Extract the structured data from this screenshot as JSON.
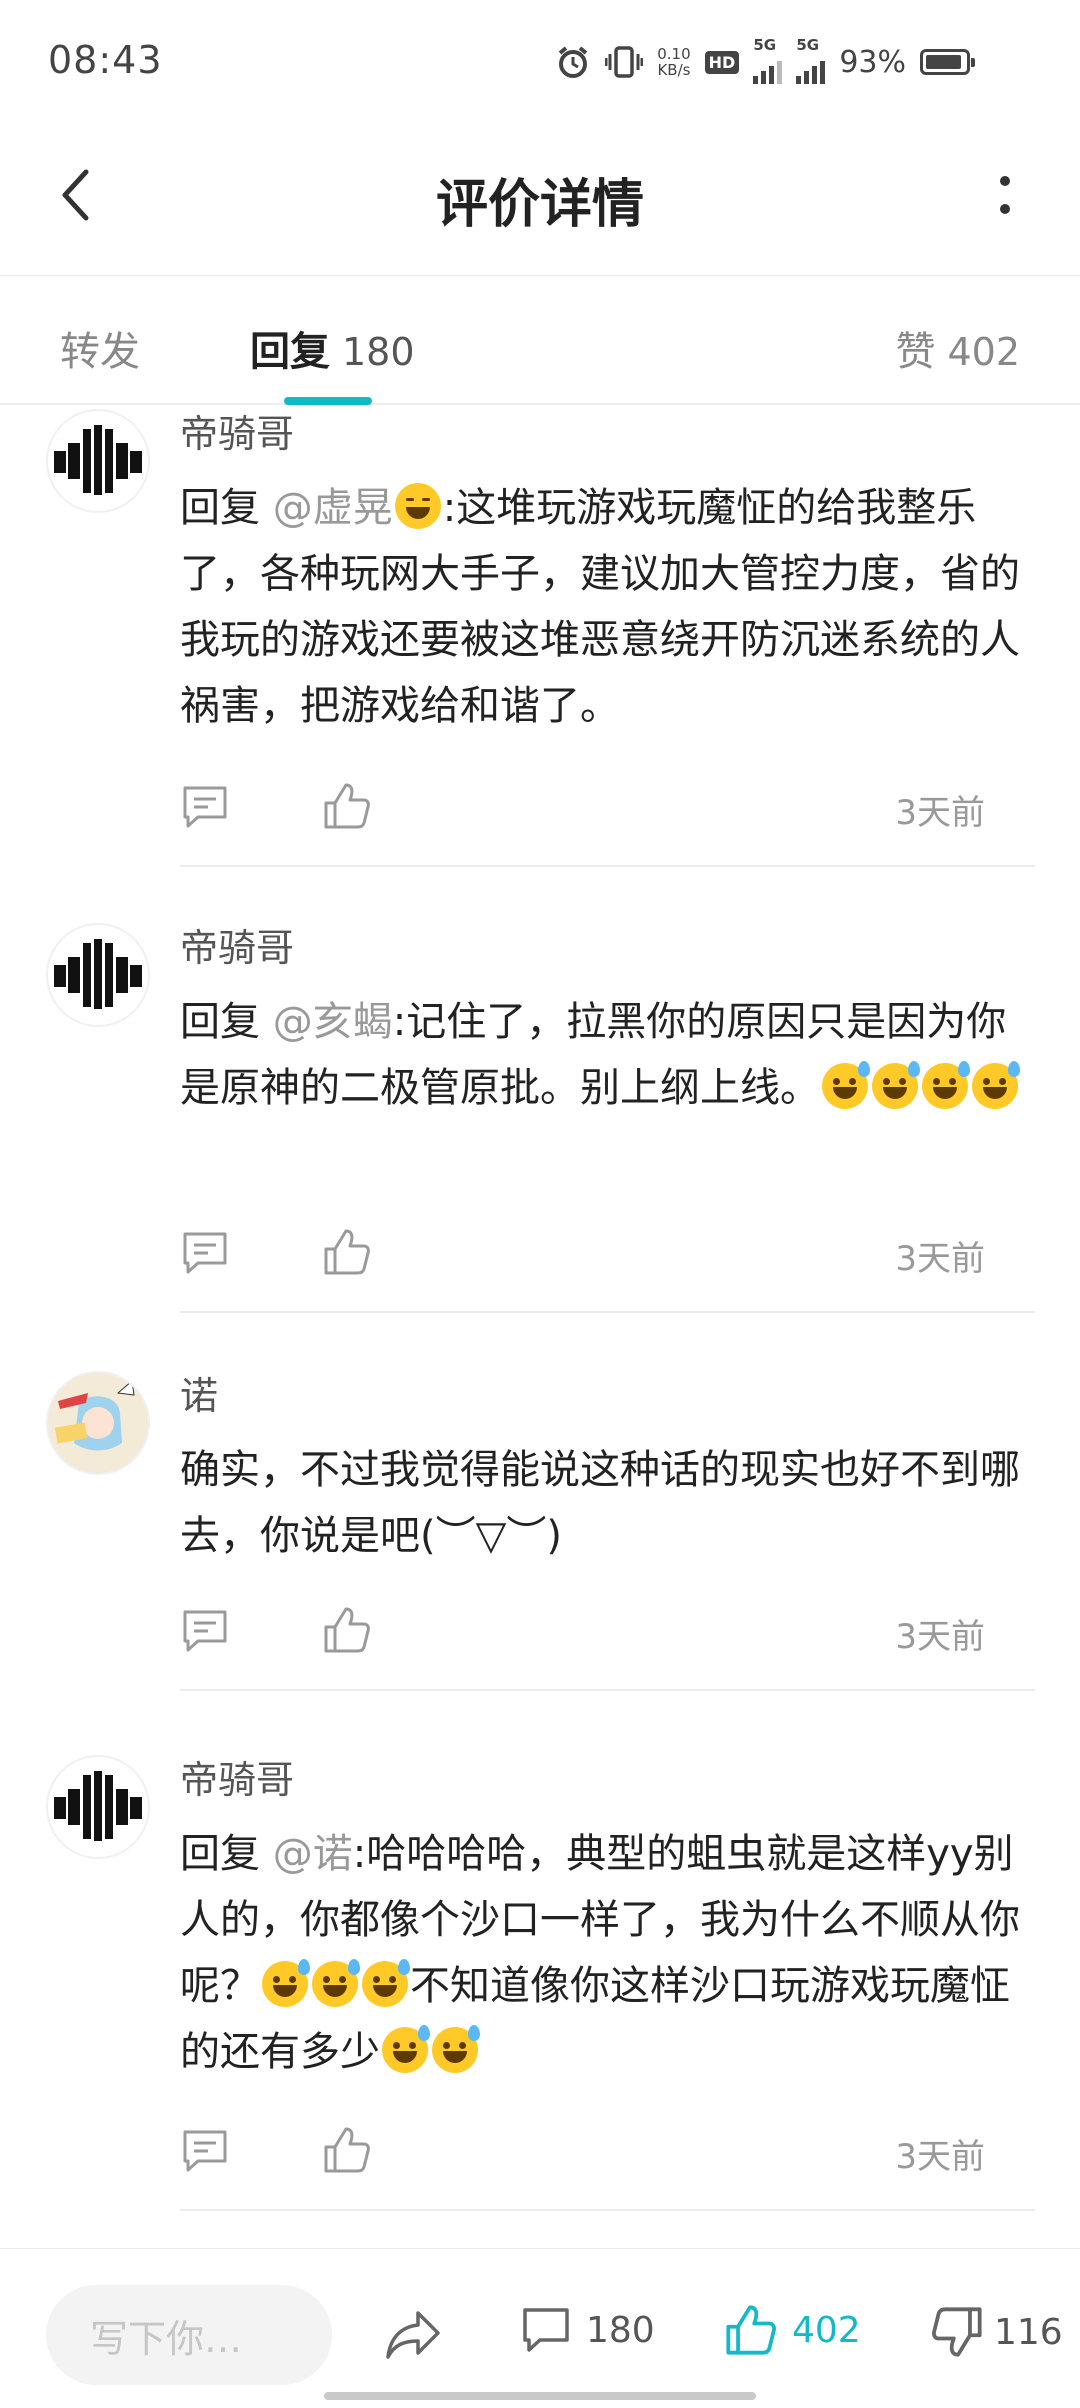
{
  "status_bar": {
    "time": "08:43",
    "net_speed_value": "0.10",
    "net_speed_unit": "KB/s",
    "battery_percent": "93%",
    "hd_badge": "HD",
    "sim1": "5G",
    "sim2": "5G",
    "icons": [
      "alarm-icon",
      "vibrate-icon",
      "hd-icon",
      "signal-icon",
      "signal-icon",
      "battery-icon"
    ]
  },
  "header": {
    "title": "评价详情",
    "back_icon": "chevron-left-icon",
    "more_icon": "more-vertical-icon"
  },
  "tabs": {
    "forward": {
      "label": "转发"
    },
    "reply": {
      "label": "回复",
      "count": "180",
      "active": true
    },
    "like": {
      "label": "赞",
      "count": "402"
    }
  },
  "comments": [
    {
      "user": "帝骑哥",
      "reply_prefix": " 回复 ",
      "mention": "@虚晃",
      "text_before_emoji": "",
      "emoji_after_mention": "wink",
      "text": ":这堆玩游戏玩魔怔的给我整乐了，各种玩网大手子，建议加大管控力度，省的我玩的游戏还要被这堆恶意绕开防沉迷系统的人祸害，把游戏给和谐了。",
      "time": "3天前"
    },
    {
      "user": "帝骑哥",
      "reply_prefix": " 回复 ",
      "mention": "@亥蝎",
      "text": ":记住了，拉黑你的原因只是因为你是原神的二极管原批。别上纲上线。",
      "trailing_emoji_count": 4,
      "time": "3天前"
    },
    {
      "user": "诺",
      "text": "确实，不过我觉得能说这种话的现实也好不到哪去，你说是吧(︶▽︶)",
      "time": "3天前"
    },
    {
      "user": "帝骑哥",
      "reply_prefix": " 回复 ",
      "mention": "@诺",
      "text_part1": ":哈哈哈哈，典型的蛆虫就是这样yy别人的，你都像个沙口一样了，我为什么不顺从你呢？",
      "text_part2": "不知道像你这样沙口玩游戏玩魔怔的还有多少",
      "time": "3天前"
    }
  ],
  "bottom_bar": {
    "input_placeholder": "写下你…",
    "reply_count": "180",
    "like_count": "402",
    "dislike_count": "116"
  },
  "colors": {
    "accent": "#14b9c8",
    "text_primary": "#222222",
    "text_secondary": "#999999"
  }
}
